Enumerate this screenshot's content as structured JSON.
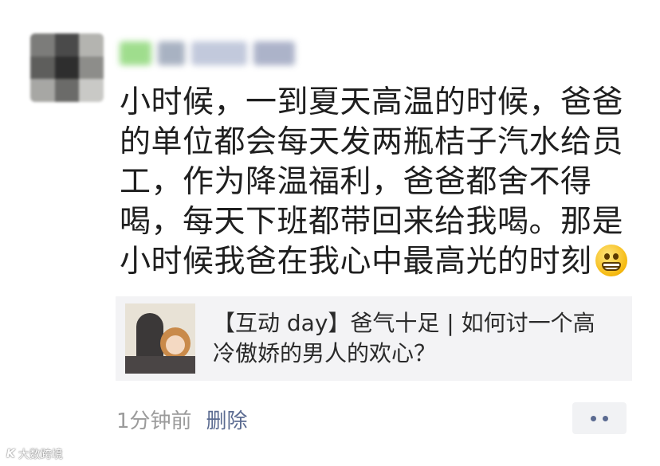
{
  "post": {
    "text": "小时候，一到夏天高温的时候，爸爸的单位都会每天发两瓶桔子汽水给员工，作为降温福利，爸爸都舍不得喝，每天下班都带回来给我喝。那是小时候我爸在我心中最高光的时刻",
    "emoji": "grinning-face-icon"
  },
  "share_card": {
    "title": "【互动 day】爸气十足 | 如何讨一个高冷傲娇的男人的欢心？"
  },
  "footer": {
    "time": "1分钟前",
    "delete_label": "删除"
  },
  "watermark": {
    "logo": "K",
    "text": "大数跨境"
  },
  "colors": {
    "link": "#5b6b91",
    "meta": "#9b9b9b",
    "card_bg": "#f3f3f5"
  }
}
